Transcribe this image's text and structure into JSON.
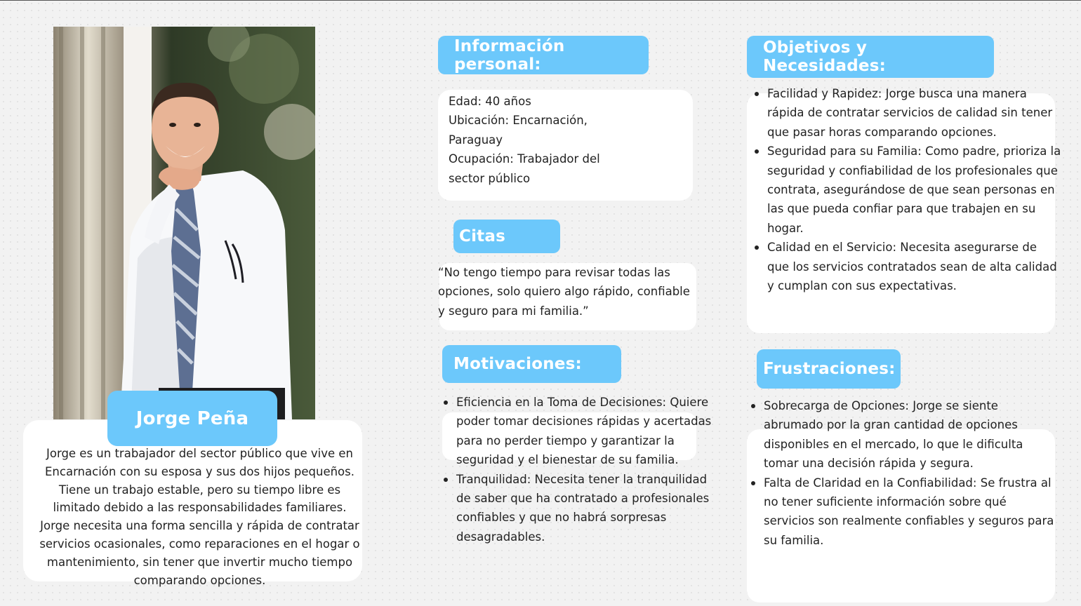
{
  "persona": {
    "name": "Jorge Peña",
    "bio": "Jorge es un trabajador del sector público que vive en Encarnación con su esposa y sus dos hijos pequeños. Tiene un trabajo estable, pero su tiempo libre es limitado debido a las responsabilidades familiares. Jorge necesita una forma sencilla y rápida de contratar servicios ocasionales, como reparaciones en el hogar o mantenimiento, sin tener que invertir mucho tiempo comparando opciones."
  },
  "personal_info": {
    "title": "Información personal:",
    "lines": [
      "Edad: 40 años",
      "Ubicación: Encarnación,",
      "Paraguay",
      "Ocupación: Trabajador del",
      "sector público"
    ]
  },
  "quotes": {
    "title": "Citas",
    "text": "“No tengo tiempo para revisar todas las opciones, solo quiero algo rápido, confiable y seguro para mi familia.”"
  },
  "motivations": {
    "title": "Motivaciones:",
    "items": [
      "Eficiencia en la Toma de Decisiones: Quiere poder tomar decisiones rápidas y acertadas para no perder tiempo y garantizar la seguridad y el bienestar de su familia.",
      "Tranquilidad: Necesita tener la tranquilidad de saber que ha contratado a profesionales confiables y que no habrá sorpresas desagradables."
    ]
  },
  "goals": {
    "title": "Objetivos y Necesidades:",
    "items": [
      "Facilidad y Rapidez: Jorge busca una manera rápida de contratar servicios de calidad sin tener que pasar horas comparando opciones.",
      "Seguridad para su Familia: Como padre, prioriza la seguridad y confiabilidad de los profesionales que contrata, asegurándose de que sean personas en las que pueda confiar para que trabajen en su hogar.",
      "Calidad en el Servicio: Necesita asegurarse de que los servicios contratados sean de alta calidad y cumplan con sus expectativas."
    ]
  },
  "frustrations": {
    "title": "Frustraciones:",
    "items": [
      "Sobrecarga de Opciones: Jorge se siente abrumado por la gran cantidad de opciones disponibles en el mercado, lo que le dificulta tomar una decisión rápida y segura.",
      "Falta de Claridad en la Confiabilidad: Se frustra al no tener suficiente información sobre qué servicios son realmente confiables y seguros para su familia."
    ]
  },
  "colors": {
    "accent": "#6cc8fb",
    "card": "#ffffff",
    "background": "#f2f2f2",
    "text": "#222222"
  }
}
